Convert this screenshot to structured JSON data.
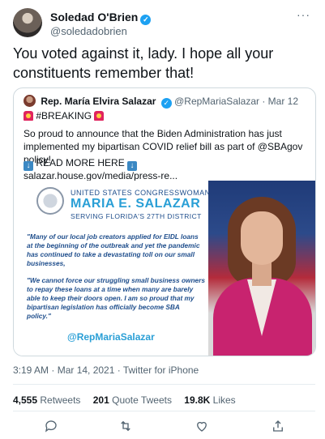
{
  "author": {
    "name": "Soledad O'Brien",
    "handle": "@soledadobrien"
  },
  "tweet": {
    "text": "You voted against it, lady. I hope all your constituents remember that!",
    "timestamp": "3:19 AM · Mar 14, 2021 · Twitter for iPhone"
  },
  "quoted": {
    "name": "Rep. María Elvira Salazar",
    "handle": "@RepMariaSalazar",
    "date": "· Mar 12",
    "line1": "#BREAKING",
    "body": "So proud to announce that the Biden Administration has just implemented my bipartisan COVID relief bill as part of @SBAgov policy!",
    "read_more": "READ MORE HERE",
    "link": "salazar.house.gov/media/press-re...",
    "image": {
      "banner_top": "UNITED STATES CONGRESSWOMAN",
      "banner_name": "MARIA E. SALAZAR",
      "banner_sub": "SERVING FLORIDA'S 27TH DISTRICT",
      "quote1": "\"Many of our local job creators applied for EIDL loans at the beginning of the outbreak and yet the pandemic has continued to take a devastating toll on our small businesses,",
      "quote2": "\"We cannot force our struggling small business owners to repay these loans at a time when many are barely able to keep their doors open. I am so proud that my bipartisan legislation has officially become SBA policy.\"",
      "handle": "@RepMariaSalazar"
    }
  },
  "stats": {
    "retweets_count": "4,555",
    "retweets_label": "Retweets",
    "quotes_count": "201",
    "quotes_label": "Quote Tweets",
    "likes_count": "19.8K",
    "likes_label": "Likes"
  },
  "colors": {
    "verified": "#1da1f2",
    "muted_text": "#536471",
    "image_blue": "#1f4e8c",
    "image_accent": "#2a9fd6"
  },
  "icons": [
    "verified-icon",
    "more-icon",
    "alarm-icon",
    "down-arrow-icon",
    "reply-icon",
    "retweet-icon",
    "like-icon",
    "share-icon"
  ]
}
